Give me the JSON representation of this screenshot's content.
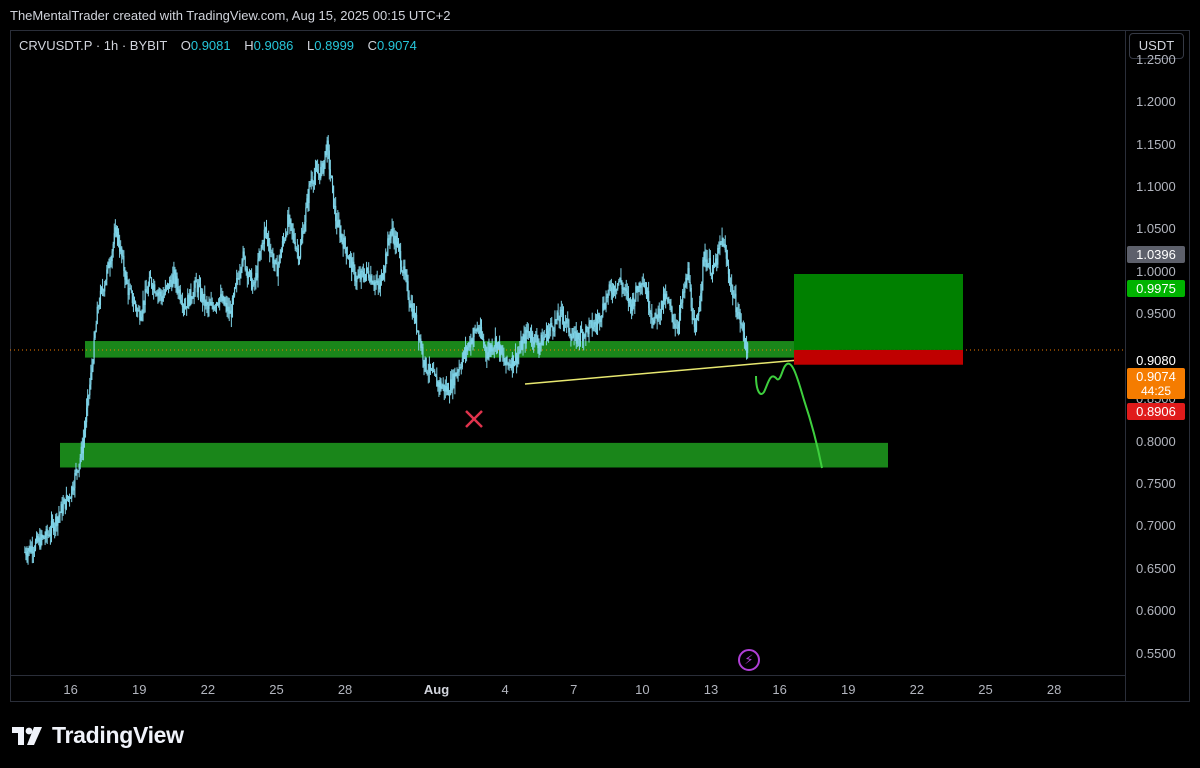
{
  "header": {
    "text": "TheMentalTrader created with TradingView.com, Aug 15, 2025 00:15 UTC+2"
  },
  "legend": {
    "symbol": "CRVUSDT.P · 1h · BYBIT",
    "open_label": "O",
    "open": "0.9081",
    "high_label": "H",
    "high": "0.9086",
    "low_label": "L",
    "low": "0.8999",
    "close_label": "C",
    "close": "0.9074"
  },
  "currency_button": "USDT",
  "y_ticks": [
    "1.2500",
    "1.2000",
    "1.1500",
    "1.1000",
    "1.0500",
    "1.0000",
    "0.9500",
    "0.9000",
    "0.8500",
    "0.8000",
    "0.7500",
    "0.7000",
    "0.6500",
    "0.6000",
    "0.5500"
  ],
  "x_ticks": [
    {
      "label": "16",
      "day": 16
    },
    {
      "label": "19",
      "day": 19
    },
    {
      "label": "22",
      "day": 22
    },
    {
      "label": "25",
      "day": 25
    },
    {
      "label": "28",
      "day": 28
    },
    {
      "label": "Aug",
      "day": 32,
      "bold": true
    },
    {
      "label": "4",
      "day": 35
    },
    {
      "label": "7",
      "day": 38
    },
    {
      "label": "10",
      "day": 41
    },
    {
      "label": "13",
      "day": 44
    },
    {
      "label": "16",
      "day": 47
    },
    {
      "label": "19",
      "day": 50
    },
    {
      "label": "22",
      "day": 53
    },
    {
      "label": "25",
      "day": 56
    },
    {
      "label": "28",
      "day": 59
    }
  ],
  "price_labels": [
    {
      "text": "1.0396",
      "price": 1.0396,
      "bg": "#5d606b",
      "color": "#ffffff"
    },
    {
      "text": "0.9975",
      "price": 0.9975,
      "bg": "#00b300",
      "color": "#ffffff"
    },
    {
      "text": "0.9080",
      "price": 0.908,
      "bg": "#000000",
      "color": "#ffffff"
    },
    {
      "text": "0.9074",
      "sub": "44:25",
      "price": 0.9074,
      "bg": "#f57c00",
      "color": "#ffffff"
    },
    {
      "text": "0.8906",
      "price": 0.8906,
      "bg": "#e01b1b",
      "color": "#ffffff"
    }
  ],
  "footer": {
    "brand": "TradingView"
  },
  "colors": {
    "candle": "#7fd4e8",
    "zone": "#1f9e1f",
    "target": "#008000",
    "stop": "#c00000",
    "trendline": "#e8e870",
    "projection": "#3ecf3e",
    "marker": "#e0334d"
  },
  "chart_data": {
    "type": "line",
    "series": [
      {
        "x": [
          14.0,
          15.0,
          15.5,
          16.0,
          16.5,
          16.9,
          17.2,
          17.6,
          18.0,
          18.5,
          19.0,
          19.5,
          20.0,
          20.5,
          21.0,
          21.5,
          22.0,
          22.5,
          23.0,
          23.5,
          24.0,
          24.5,
          25.0,
          25.5,
          26.0,
          26.5,
          27.0,
          27.2,
          27.6,
          28.0,
          28.5,
          29.0,
          29.5,
          30.0,
          30.3,
          30.8,
          31.2,
          31.5,
          32.0,
          32.5,
          33.0,
          33.5,
          33.8,
          34.2,
          34.6,
          35.0,
          35.5,
          36.0,
          36.5,
          37.0,
          37.5,
          38.0,
          38.5,
          39.0,
          39.5,
          40.0,
          40.5,
          41.0,
          41.5,
          42.0,
          42.5,
          43.0,
          43.3,
          43.7,
          44.1,
          44.5,
          44.9,
          45.3,
          45.6
        ],
        "y": [
          0.67,
          0.69,
          0.715,
          0.74,
          0.79,
          0.88,
          0.96,
          1.0,
          1.05,
          0.98,
          0.95,
          0.99,
          0.97,
          0.995,
          0.96,
          0.985,
          0.955,
          0.97,
          0.95,
          1.02,
          0.98,
          1.05,
          1.0,
          1.06,
          1.02,
          1.11,
          1.12,
          1.15,
          1.06,
          1.03,
          0.99,
          1.0,
          0.98,
          1.05,
          1.03,
          0.97,
          0.93,
          0.89,
          0.87,
          0.86,
          0.89,
          0.92,
          0.935,
          0.905,
          0.92,
          0.89,
          0.9,
          0.93,
          0.915,
          0.935,
          0.95,
          0.92,
          0.93,
          0.94,
          0.975,
          0.99,
          0.96,
          0.995,
          0.94,
          0.97,
          0.935,
          1.0,
          0.92,
          1.02,
          1.0,
          1.04,
          0.98,
          0.94,
          0.907
        ]
      }
    ],
    "xlim": [
      13.35,
      62.1
    ],
    "ylim": [
      0.525,
      1.285
    ],
    "grid": false
  }
}
